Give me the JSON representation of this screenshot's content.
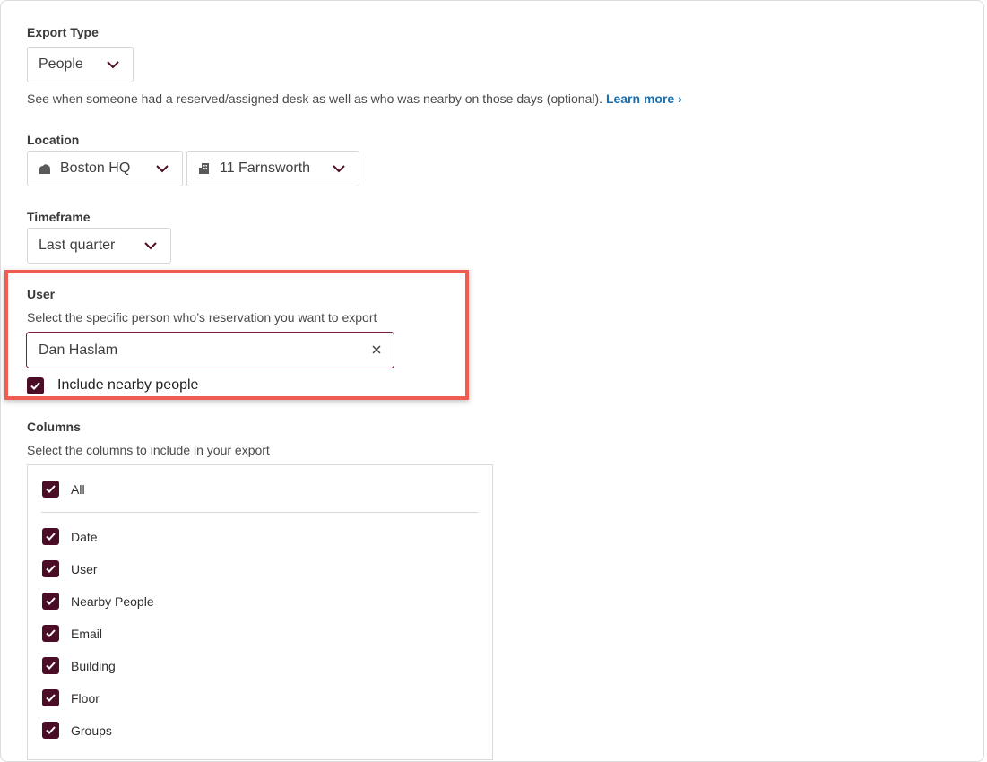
{
  "export_type": {
    "label": "Export Type",
    "value": "People",
    "description": "See when someone had a reserved/assigned desk as well as who was nearby on those days (optional).",
    "learn_more": "Learn more ›"
  },
  "location": {
    "label": "Location",
    "site": "Boston HQ",
    "site_icon": "location-icon",
    "building": "11 Farnsworth",
    "building_icon": "building-icon"
  },
  "timeframe": {
    "label": "Timeframe",
    "value": "Last quarter"
  },
  "user": {
    "label": "User",
    "description": "Select the specific person who’s reservation you want to export",
    "value": "Dan Haslam",
    "include_nearby_label": "Include nearby people",
    "include_nearby_checked": true
  },
  "columns": {
    "label": "Columns",
    "description": "Select the columns to include in your export",
    "all_label": "All",
    "items": [
      {
        "label": "Date",
        "checked": true
      },
      {
        "label": "User",
        "checked": true
      },
      {
        "label": "Nearby People",
        "checked": true
      },
      {
        "label": "Email",
        "checked": true
      },
      {
        "label": "Building",
        "checked": true
      },
      {
        "label": "Floor",
        "checked": true
      },
      {
        "label": "Groups",
        "checked": true
      }
    ]
  },
  "colors": {
    "accent": "#4b0d26",
    "input_focus_border": "#7a1d3c",
    "highlight_border": "#f05b52",
    "link": "#1a6fb0"
  }
}
